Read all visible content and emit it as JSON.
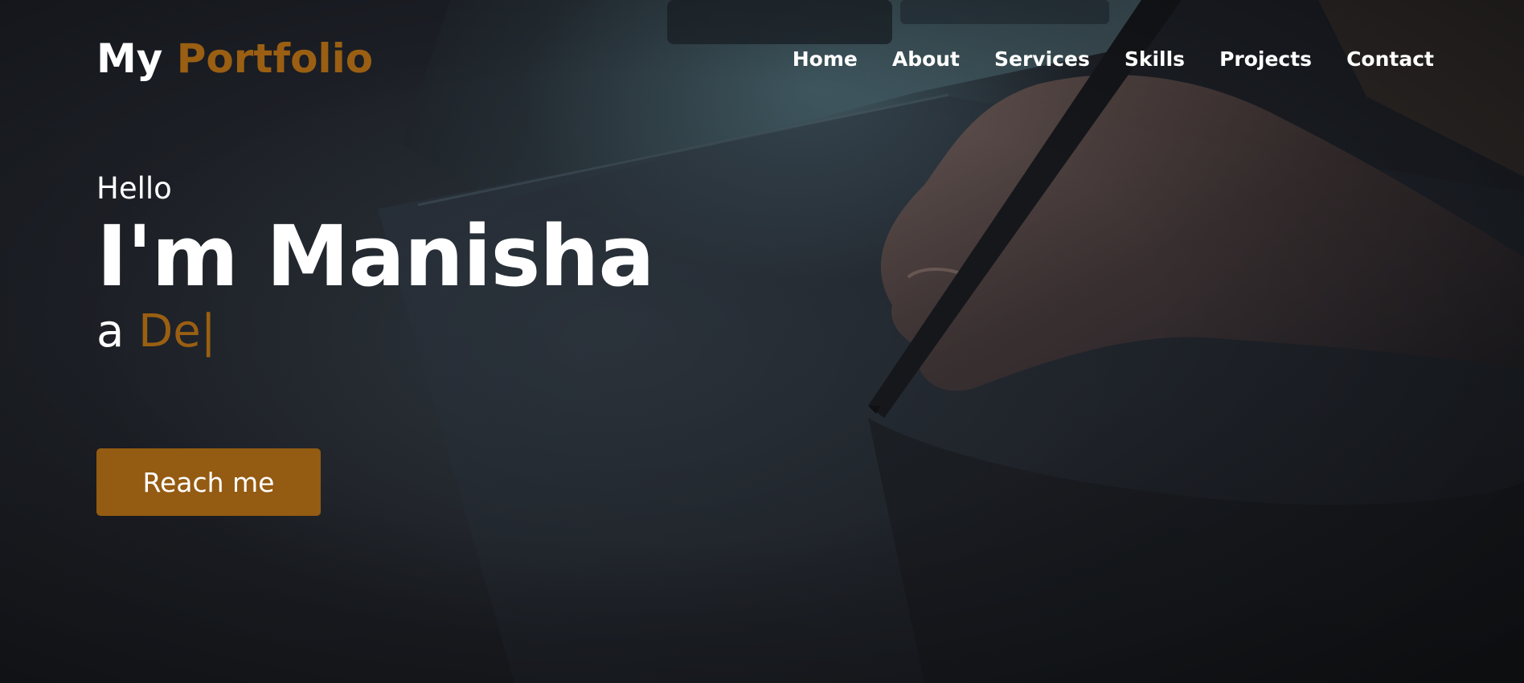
{
  "header": {
    "logo_main": "My ",
    "logo_accent": "Portfolio"
  },
  "nav": {
    "items": [
      "Home",
      "About",
      "Services",
      "Skills",
      "Projects",
      "Contact"
    ]
  },
  "hero": {
    "greeting": "Hello",
    "name": "I'm Manisha",
    "role_prefix": "a ",
    "role_typed": "De",
    "cursor": "|",
    "button_label": "Reach me"
  },
  "colors": {
    "accent": "#9a5f12",
    "button": "#945b12",
    "background": "#1b1d23",
    "text": "#ffffff"
  }
}
